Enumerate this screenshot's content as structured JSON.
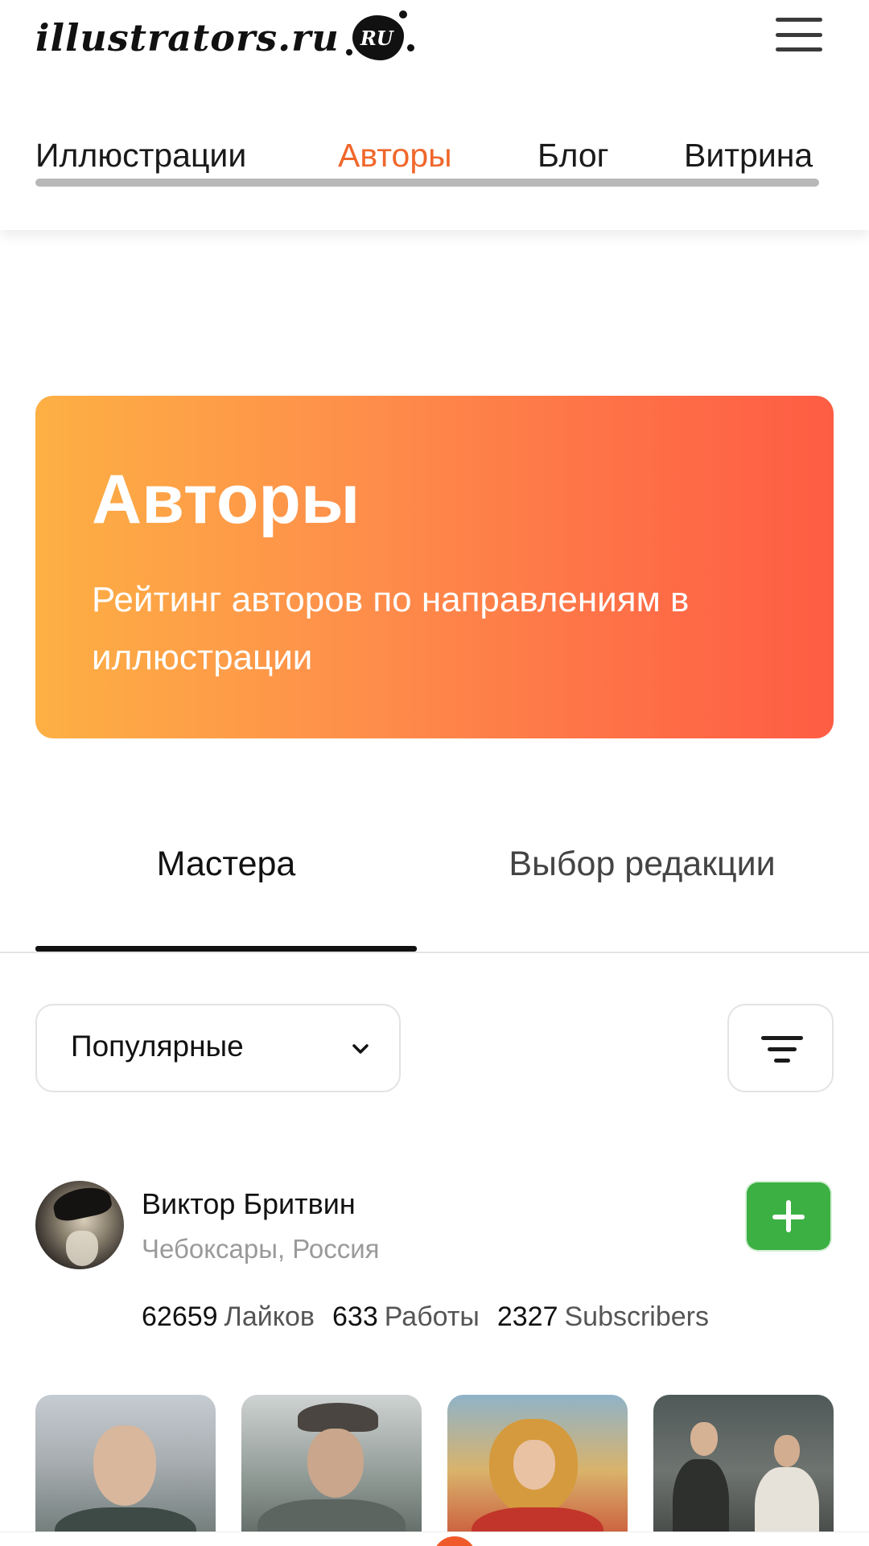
{
  "header": {
    "logo": "illustrators.ru",
    "logo_badge": "RU",
    "menu_icon": "hamburger-icon",
    "nav": [
      {
        "label": "Иллюстрации",
        "active": false
      },
      {
        "label": "Авторы",
        "active": true
      },
      {
        "label": "Блог",
        "active": false
      },
      {
        "label": "Витрина",
        "active": false
      }
    ],
    "accent_color": "#f0672b"
  },
  "hero": {
    "title": "Авторы",
    "subtitle": "Рейтинг авторов по направлениям в иллюстрации",
    "gradient": [
      "#fdb044",
      "#fe5d44"
    ]
  },
  "tabs": [
    {
      "label": "Мастера",
      "active": true
    },
    {
      "label": "Выбор редакции",
      "active": false
    }
  ],
  "controls": {
    "sort_value": "Популярные",
    "sort_icon": "chevron-down-icon",
    "filter_icon": "filter-icon"
  },
  "author": {
    "name": "Виктор Бритвин",
    "location": "Чебоксары, Россия",
    "follow_icon": "plus-icon",
    "follow_color": "#3cb043",
    "stats": [
      {
        "value": "62659",
        "label": "Лайков"
      },
      {
        "value": "633",
        "label": "Работы"
      },
      {
        "value": "2327",
        "label": "Subscribers"
      }
    ]
  }
}
